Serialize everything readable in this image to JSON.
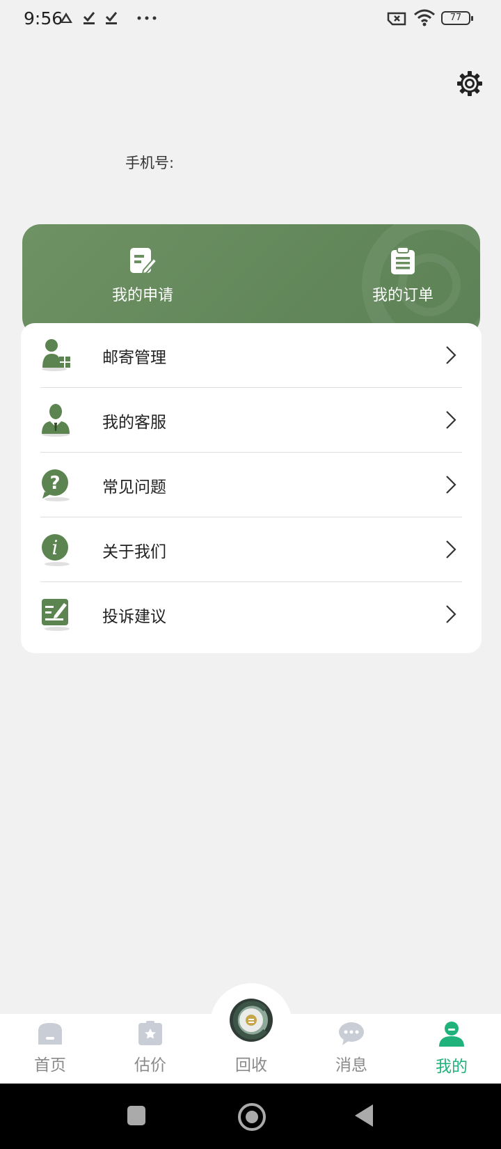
{
  "status_bar": {
    "time": "9:56",
    "battery": "77"
  },
  "profile": {
    "phone_label": "手机号:"
  },
  "quick_actions": {
    "apply": "我的申请",
    "order": "我的订单"
  },
  "menu": [
    {
      "label": "邮寄管理",
      "icon": "mailing-admin-icon"
    },
    {
      "label": "我的客服",
      "icon": "customer-service-icon"
    },
    {
      "label": "常见问题",
      "icon": "question-icon"
    },
    {
      "label": "关于我们",
      "icon": "info-icon"
    },
    {
      "label": "投诉建议",
      "icon": "feedback-icon"
    }
  ],
  "bottom_nav": {
    "home": "首页",
    "estimate": "估价",
    "recycle": "回收",
    "messages": "消息",
    "mine": "我的"
  },
  "colors": {
    "brand_green": "#62875a",
    "active_tab": "#1fb37b"
  }
}
